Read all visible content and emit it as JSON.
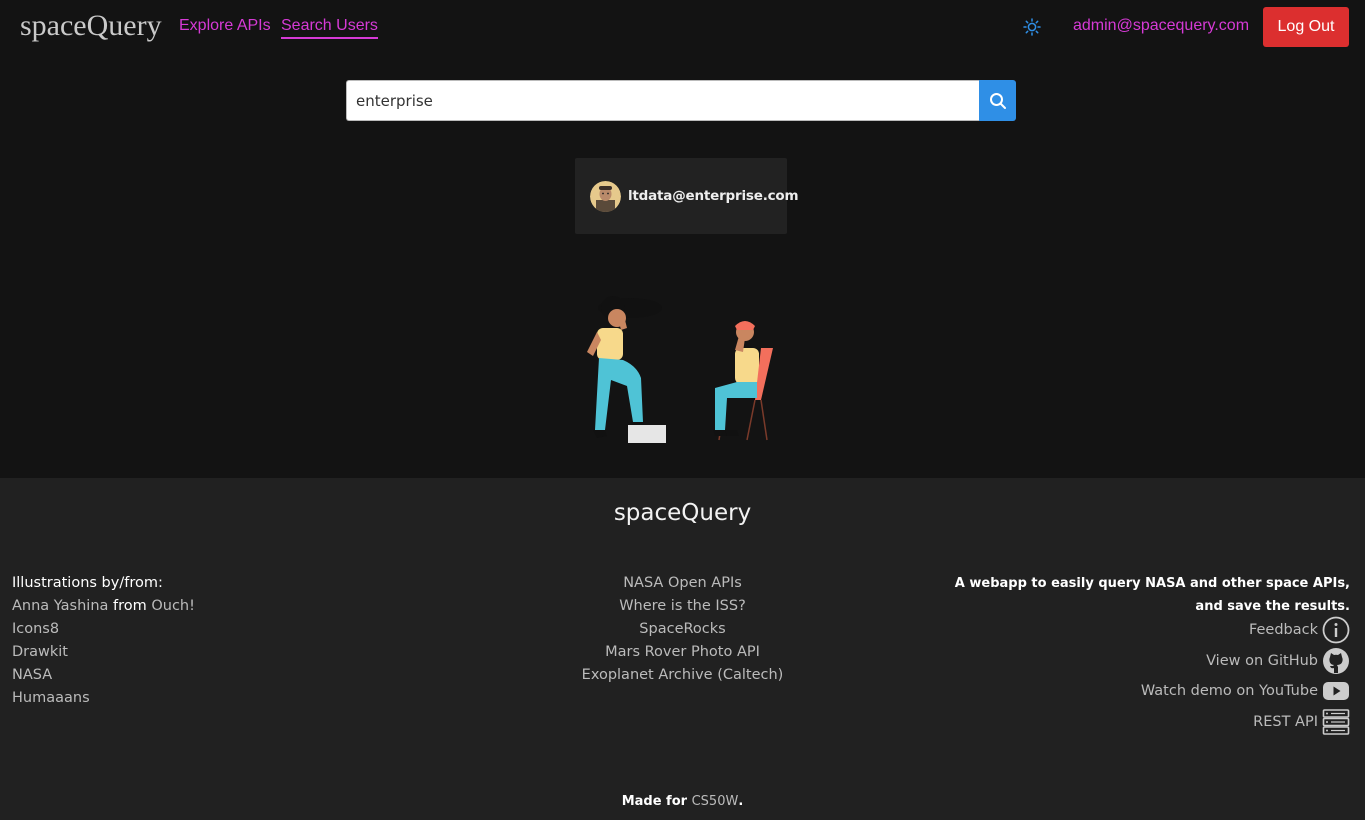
{
  "header": {
    "brand": "spaceQuery",
    "nav": {
      "explore": "Explore APIs",
      "search_users": "Search Users"
    },
    "user_email": "admin@spacequery.com",
    "logout_label": "Log Out"
  },
  "search": {
    "value": "enterprise",
    "placeholder": ""
  },
  "results": [
    {
      "email": "ltdata@enterprise.com"
    }
  ],
  "footer": {
    "title": "spaceQuery",
    "credits": {
      "heading": "Illustrations by/from:",
      "line1_name": "Anna Yashina",
      "line1_from": "from",
      "line1_source": "Ouch!",
      "items": [
        "Icons8",
        "Drawkit",
        "NASA",
        "Humaaans"
      ]
    },
    "api_links": [
      "NASA Open APIs",
      "Where is the ISS?",
      "SpaceRocks",
      "Mars Rover Photo API",
      "Exoplanet Archive (Caltech)"
    ],
    "about": "A webapp to easily query NASA and other space APIs, and save the results.",
    "right_links": {
      "feedback": "Feedback",
      "github": "View on GitHub",
      "youtube": "Watch demo on YouTube",
      "rest_api": "REST API"
    },
    "made_for_prefix": "Made for",
    "made_for_link": "CS50W",
    "made_for_suffix": "."
  },
  "colors": {
    "accent": "#d63ad6",
    "logout": "#dc2f2f",
    "search_button": "#2f8fe6",
    "background": "#131313",
    "footer_background": "#212121"
  }
}
